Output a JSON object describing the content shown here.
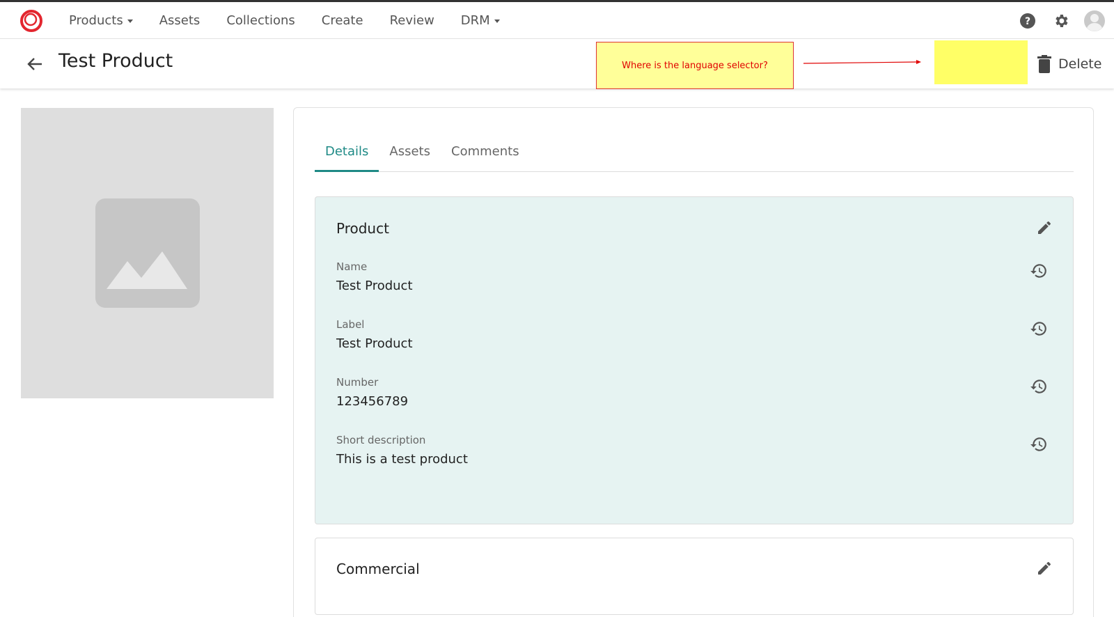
{
  "nav": {
    "items": [
      {
        "label": "Products",
        "dropdown": true
      },
      {
        "label": "Assets",
        "dropdown": false
      },
      {
        "label": "Collections",
        "dropdown": false
      },
      {
        "label": "Create",
        "dropdown": false
      },
      {
        "label": "Review",
        "dropdown": false
      },
      {
        "label": "DRM",
        "dropdown": true
      }
    ],
    "icons": [
      "help-icon",
      "gear-icon",
      "account-icon"
    ]
  },
  "header": {
    "title": "Test Product",
    "note": "Where is the language selector?",
    "delete_label": "Delete"
  },
  "tabs": [
    {
      "label": "Details",
      "active": true
    },
    {
      "label": "Assets",
      "active": false
    },
    {
      "label": "Comments",
      "active": false
    }
  ],
  "sections": {
    "product": {
      "title": "Product",
      "fields": [
        {
          "label": "Name",
          "value": "Test Product"
        },
        {
          "label": "Label",
          "value": "Test Product"
        },
        {
          "label": "Number",
          "value": "123456789"
        },
        {
          "label": "Short description",
          "value": "This is a test product"
        }
      ]
    },
    "commercial": {
      "title": "Commercial"
    }
  },
  "colors": {
    "accent": "#1f8a86",
    "brand": "#e3262f",
    "section_bg": "#e6f3f2",
    "note_bg": "#ffff99",
    "note_text": "#e00000",
    "highlight": "#ffff66"
  }
}
